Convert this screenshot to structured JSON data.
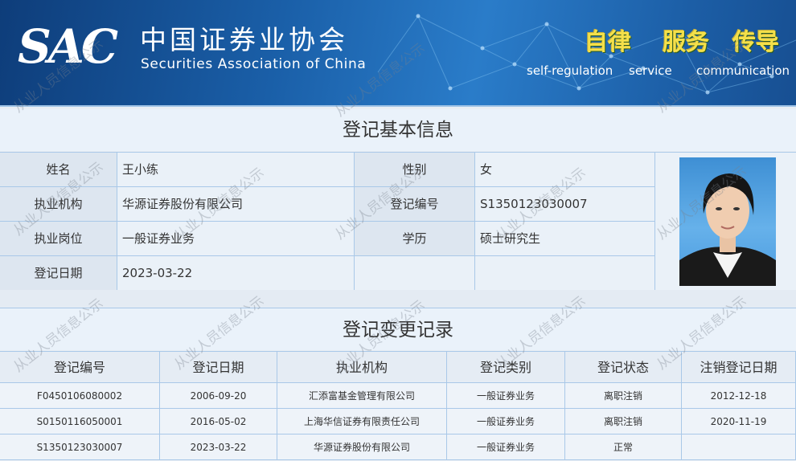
{
  "header": {
    "logo": "SAC",
    "org_name_cn": "中国证券业协会",
    "org_name_en": "Securities Association of China",
    "motto": [
      {
        "cn": "自律",
        "en": "self-regulation"
      },
      {
        "cn": "服务",
        "en": "service"
      },
      {
        "cn": "传导",
        "en": "communication"
      }
    ]
  },
  "basic_info": {
    "title": "登记基本信息",
    "name_label": "姓名",
    "name": "王小练",
    "gender_label": "性别",
    "gender": "女",
    "org_label": "执业机构",
    "org": "华源证券股份有限公司",
    "reg_no_label": "登记编号",
    "reg_no": "S1350123030007",
    "post_label": "执业岗位",
    "post": "一般证券业务",
    "edu_label": "学历",
    "edu": "硕士研究生",
    "date_label": "登记日期",
    "date": "2023-03-22"
  },
  "records": {
    "title": "登记变更记录",
    "headers": [
      "登记编号",
      "登记日期",
      "执业机构",
      "登记类别",
      "登记状态",
      "注销登记日期"
    ],
    "rows": [
      [
        "F0450106080002",
        "2006-09-20",
        "汇添富基金管理有限公司",
        "一般证券业务",
        "离职注销",
        "2012-12-18"
      ],
      [
        "S0150116050001",
        "2016-05-02",
        "上海华信证券有限责任公司",
        "一般证券业务",
        "离职注销",
        "2020-11-19"
      ],
      [
        "S1350123030007",
        "2023-03-22",
        "华源证券股份有限公司",
        "一般证券业务",
        "正常",
        ""
      ]
    ]
  },
  "watermark": "从业人员信息公示",
  "colors": {
    "banner": "#1a5fa8",
    "motto": "#f4e04a",
    "border": "#a9c8e8"
  }
}
